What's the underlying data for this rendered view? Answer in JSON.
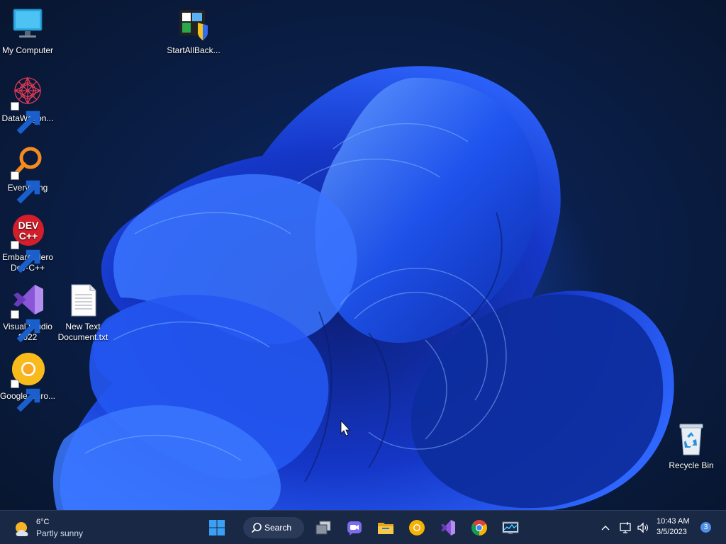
{
  "desktop": {
    "icons": [
      {
        "label": "My Computer",
        "icon": "computer-monitor-icon"
      },
      {
        "label": "StartAllBack...",
        "icon": "startallback-shield-icon"
      },
      {
        "label": "DataWagon...",
        "icon": "datawagon-mandala-icon"
      },
      {
        "label": "Everything",
        "icon": "magnifier-ring-icon"
      },
      {
        "label": "Embarcadero Dev-C++",
        "icon": "devcpp-red-circle-icon"
      },
      {
        "label": "Visual Studio 2022",
        "icon": "visual-studio-icon"
      },
      {
        "label": "New Text Document.txt",
        "icon": "text-document-icon"
      },
      {
        "label": "Google Chro...",
        "icon": "chrome-canary-icon"
      },
      {
        "label": "Recycle Bin",
        "icon": "recycle-bin-icon"
      }
    ],
    "wallpaper": "windows-11-bloom-wallpaper"
  },
  "taskbar": {
    "weather": {
      "temp": "6°C",
      "condition": "Partly sunny",
      "icon": "partly-sunny-icon"
    },
    "search": {
      "label": "Search"
    },
    "apps": [
      {
        "name": "start",
        "icon": "windows-start-icon"
      },
      {
        "name": "task-view",
        "icon": "task-view-icon"
      },
      {
        "name": "teams-chat",
        "icon": "chat-camera-icon"
      },
      {
        "name": "file-explorer",
        "icon": "folder-icon"
      },
      {
        "name": "chrome-canary",
        "icon": "chrome-canary-icon"
      },
      {
        "name": "visual-studio",
        "icon": "visual-studio-icon"
      },
      {
        "name": "chrome",
        "icon": "chrome-icon"
      },
      {
        "name": "resource-monitor",
        "icon": "monitor-chart-icon"
      }
    ],
    "tray": {
      "icons": [
        "chevron-up-icon",
        "network-icon",
        "speaker-icon"
      ],
      "time": "10:43 AM",
      "date": "3/5/2023",
      "notification_count": "3"
    }
  },
  "colors": {
    "accent": "#2f6cf5",
    "taskbar_bg": "#182845",
    "wallpaper_dark": "#081630"
  }
}
